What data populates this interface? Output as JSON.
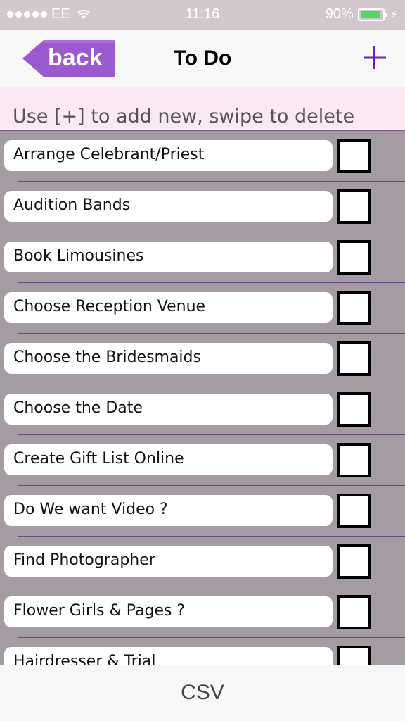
{
  "status_bar": {
    "carrier": "EE",
    "time": "11:16",
    "battery_percent": "90%",
    "battery_level": 0.9,
    "signal_icon": "signal-dots-icon",
    "wifi_icon": "wifi-icon",
    "battery_icon": "battery-icon",
    "charging_icon": "charging-bolt-icon"
  },
  "nav": {
    "back_label": "back",
    "title": "To Do",
    "add_icon": "plus-icon",
    "accent_color": "#6a1fb3"
  },
  "hint": "Use [+]  to add new, swipe to delete",
  "items": [
    {
      "label": "Arrange Celebrant/Priest",
      "checked": false
    },
    {
      "label": "Audition Bands",
      "checked": false
    },
    {
      "label": "Book Limousines",
      "checked": false
    },
    {
      "label": "Choose Reception Venue",
      "checked": false
    },
    {
      "label": "Choose the Bridesmaids",
      "checked": false
    },
    {
      "label": "Choose the Date",
      "checked": false
    },
    {
      "label": "Create Gift List Online",
      "checked": false
    },
    {
      "label": "Do We want Video ?",
      "checked": false
    },
    {
      "label": "Find Photographer",
      "checked": false
    },
    {
      "label": "Flower Girls & Pages ?",
      "checked": false
    },
    {
      "label": "Hairdresser & Trial",
      "checked": false
    }
  ],
  "bottom": {
    "csv_label": "CSV"
  }
}
